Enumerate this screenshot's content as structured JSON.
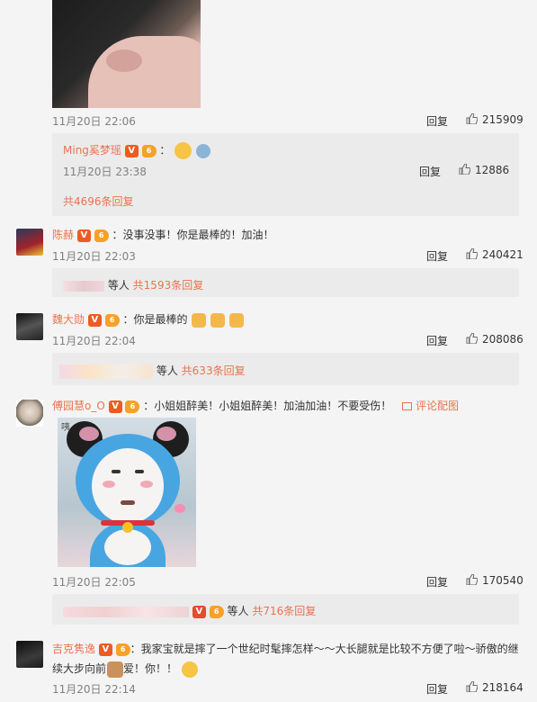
{
  "comments": [
    {
      "time": "11月20日 22:06",
      "reply": "回复",
      "likes": "215909",
      "sub": {
        "name": "Ming奚梦瑶",
        "text": "：",
        "time": "11月20日 23:38",
        "reply": "回复",
        "likes": "12886",
        "more": "共4696条回复"
      }
    },
    {
      "name": "陈赫",
      "text": "：没事没事！你是最棒的！加油！",
      "time": "11月20日 22:03",
      "reply": "回复",
      "likes": "240421",
      "sub_prefix": "等人",
      "sub_more": "共1593条回复"
    },
    {
      "name": "魏大勋",
      "text": "：你是最棒的",
      "time": "11月20日 22:04",
      "reply": "回复",
      "likes": "208086",
      "sub_prefix": "等人",
      "sub_more": "共633条回复"
    },
    {
      "name": "傅园慧o_O",
      "text": "：小姐姐醉美！小姐姐醉美！加油加油！不要受伤！",
      "link": "评论配图",
      "time": "11月20日 22:05",
      "reply": "回复",
      "likes": "170540",
      "sub_prefix": "等人",
      "sub_more": "共716条回复"
    },
    {
      "name": "吉克隽逸",
      "text_line1": "：我家宝就是摔了一个世纪时髦摔怎样～～大长腿就是比较不方便了啦～骄傲的继",
      "text_line2a": "续大步向前",
      "text_line2b": "爱！你！！",
      "time": "11月20日 22:14",
      "reply": "回复",
      "likes": "218164"
    }
  ],
  "colors": {
    "name": "#eb7350",
    "bg": "#f4f4f4",
    "sub_bg": "#ebebeb"
  }
}
